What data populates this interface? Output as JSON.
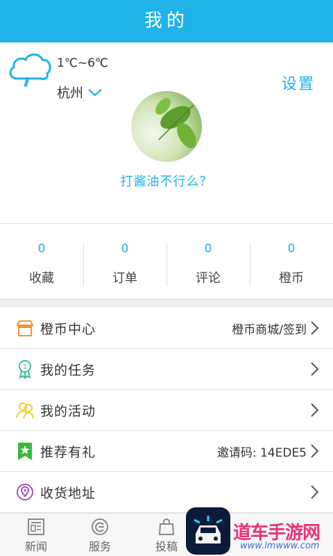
{
  "header": {
    "title": "我的"
  },
  "weather": {
    "temperature": "1℃~6℃",
    "city": "杭州",
    "icon": "rain-cloud-icon"
  },
  "settings_label": "设置",
  "profile": {
    "nickname": "打酱油不行么？",
    "avatar": "leaf-avatar"
  },
  "stats": [
    {
      "value": "0",
      "label": "收藏"
    },
    {
      "value": "0",
      "label": "订单"
    },
    {
      "value": "0",
      "label": "评论"
    },
    {
      "value": "0",
      "label": "橙币"
    }
  ],
  "menu": [
    {
      "label": "橙币中心",
      "extra": "橙币商城/签到",
      "icon": "shop-icon"
    },
    {
      "label": "我的任务",
      "extra": "",
      "icon": "badge-icon"
    },
    {
      "label": "我的活动",
      "extra": "",
      "icon": "people-icon"
    },
    {
      "label": "推荐有礼",
      "extra": "邀请码: 14EDE5",
      "icon": "star-bookmark-icon"
    },
    {
      "label": "收货地址",
      "extra": "",
      "icon": "location-icon"
    }
  ],
  "tabs": [
    {
      "label": "新闻",
      "icon": "news-icon"
    },
    {
      "label": "服务",
      "icon": "service-icon"
    },
    {
      "label": "投稿",
      "icon": "bag-icon"
    }
  ],
  "colors": {
    "accent": "#1fb3ea",
    "text": "#333333",
    "divider": "#e3e3e3"
  }
}
